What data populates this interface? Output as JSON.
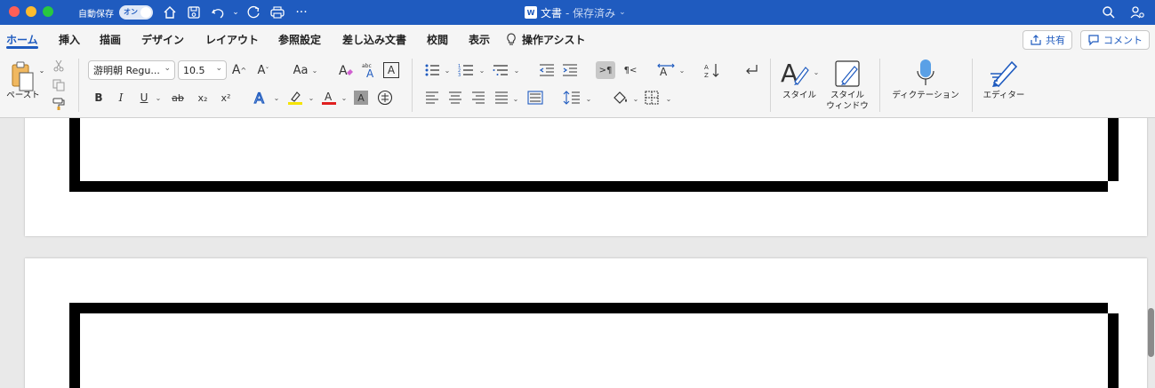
{
  "window": {
    "autosave_label": "自動保存",
    "autosave_state": "オン",
    "doc_title": "文書",
    "save_status": "- 保存済み",
    "word_badge": "W"
  },
  "tabs": [
    {
      "label": "ホーム",
      "active": true
    },
    {
      "label": "挿入"
    },
    {
      "label": "描画"
    },
    {
      "label": "デザイン"
    },
    {
      "label": "レイアウト"
    },
    {
      "label": "参照設定"
    },
    {
      "label": "差し込み文書"
    },
    {
      "label": "校閲"
    },
    {
      "label": "表示"
    },
    {
      "label": "操作アシスト"
    }
  ],
  "actions": {
    "share_label": "共有",
    "comment_label": "コメント"
  },
  "ribbon": {
    "paste_label": "ペースト",
    "font_name": "游明朝 Regu...",
    "font_size": "10.5",
    "grow_font": "A^",
    "shrink_font": "Aˇ",
    "change_case": "Aa",
    "bold": "B",
    "italic": "I",
    "underline": "U",
    "strikethrough": "ab",
    "subscript": "x₂",
    "superscript": "x²",
    "styles_label": "スタイル",
    "styles_pane_label": "スタイル\nウィンドウ",
    "dictate_label": "ディクテーション",
    "editor_label": "エディター",
    "accent_color": "#1f5bbf",
    "highlight_color": "#f5e400",
    "font_color": "#e02020"
  },
  "document": {
    "pages": 2
  }
}
